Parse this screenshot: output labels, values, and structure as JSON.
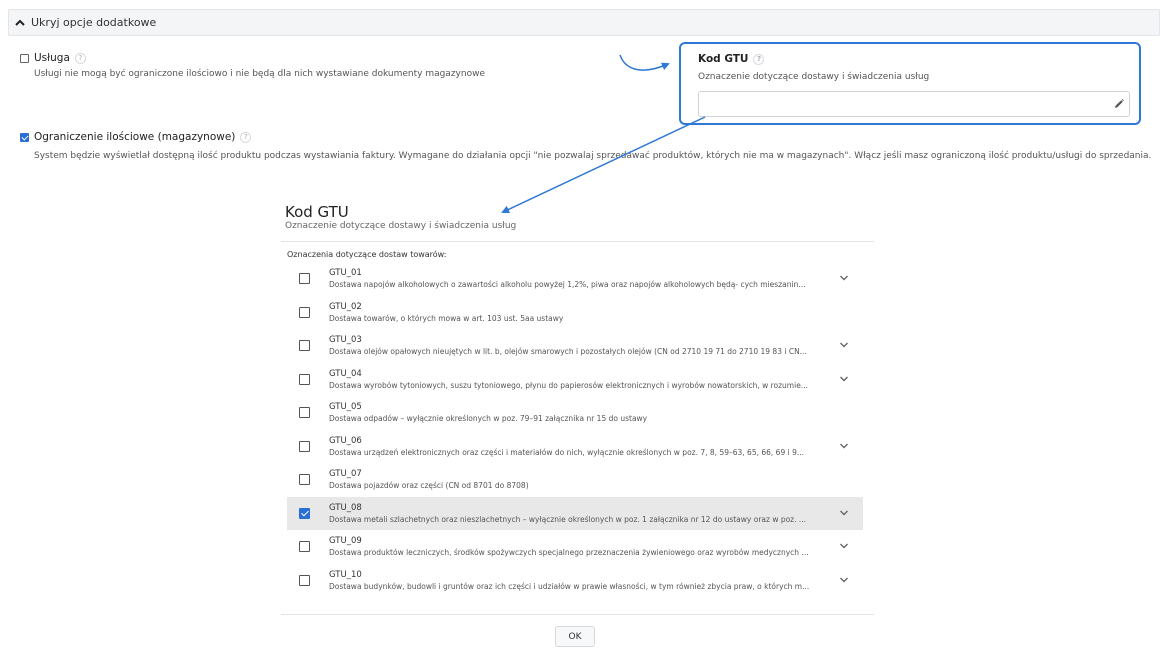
{
  "section_header": {
    "label": "Ukryj opcje dodatkowe"
  },
  "options": {
    "usluga": {
      "label": "Usługa",
      "help": "?",
      "checked": false,
      "description": "Usługi nie mogą być ograniczone ilościowo i nie będą dla nich wystawiane dokumenty magazynowe"
    },
    "ograniczenie": {
      "label": "Ograniczenie ilościowe (magazynowe)",
      "help": "?",
      "checked": true,
      "description": "System będzie wyświetlał dostępną ilość produktu podczas wystawiania faktury. Wymagane do działania opcji \"nie pozwalaj sprzedawać produktów, których nie ma w magazynach\". Włącz jeśli masz ograniczoną ilość produktu/usługi do sprzedania."
    }
  },
  "gtu_field": {
    "label": "Kod GTU",
    "help": "?",
    "description": "Oznaczenie dotyczące dostawy i świadczenia usług",
    "value": ""
  },
  "modal": {
    "title": "Kod GTU",
    "subtitle": "Oznaczenie dotyczące dostawy i świadczenia usług",
    "section_label": "Oznaczenia dotyczące dostaw towarów:",
    "items": [
      {
        "code": "GTU_01",
        "desc": "Dostawa napojów alkoholowych o zawartości alkoholu powyżej 1,2%, piwa oraz napojów alkoholowych będą- cych mieszanin...",
        "checked": false,
        "expandable": true
      },
      {
        "code": "GTU_02",
        "desc": "Dostawa towarów, o których mowa w art. 103 ust. 5aa ustawy",
        "checked": false,
        "expandable": false
      },
      {
        "code": "GTU_03",
        "desc": "Dostawa olejów opałowych nieujętych w lit. b, olejów smarowych i pozostałych olejów (CN od 2710 19 71 do 2710 19 83 i CN...",
        "checked": false,
        "expandable": true
      },
      {
        "code": "GTU_04",
        "desc": "Dostawa wyrobów tytoniowych, suszu tytoniowego, płynu do papierosów elektronicznych i wyrobów nowatorskich, w rozumie...",
        "checked": false,
        "expandable": true
      },
      {
        "code": "GTU_05",
        "desc": "Dostawa odpadów – wyłącznie określonych w poz. 79–91 załącznika nr 15 do ustawy",
        "checked": false,
        "expandable": false
      },
      {
        "code": "GTU_06",
        "desc": "Dostawa urządzeń elektronicznych oraz części i materiałów do nich, wyłącznie określonych w poz. 7, 8, 59–63, 65, 66, 69 i 9...",
        "checked": false,
        "expandable": true
      },
      {
        "code": "GTU_07",
        "desc": "Dostawa pojazdów oraz części (CN od 8701 do 8708)",
        "checked": false,
        "expandable": false
      },
      {
        "code": "GTU_08",
        "desc": "Dostawa metali szlachetnych oraz nieszlachetnych – wyłącznie określonych w poz. 1 załącznika nr 12 do ustawy oraz w poz. ...",
        "checked": true,
        "expandable": true
      },
      {
        "code": "GTU_09",
        "desc": "Dostawa produktów leczniczych, środków spożywczych specjalnego przeznaczenia żywieniowego oraz wyrobów medycznych ...",
        "checked": false,
        "expandable": true
      },
      {
        "code": "GTU_10",
        "desc": "Dostawa budynków, budowli i gruntów oraz ich części i udziałów w prawie własności, w tym również zbycia praw, o których m...",
        "checked": false,
        "expandable": true
      }
    ],
    "ok_label": "OK"
  },
  "colors": {
    "accent": "#2a6fd6",
    "highlight_border": "#2f78d6",
    "selected_row": "#e8e8e8"
  },
  "icons": {
    "header_toggle": "chevron-up-icon",
    "field_edit": "pencil-icon",
    "row_expand": "chevron-down-icon"
  }
}
